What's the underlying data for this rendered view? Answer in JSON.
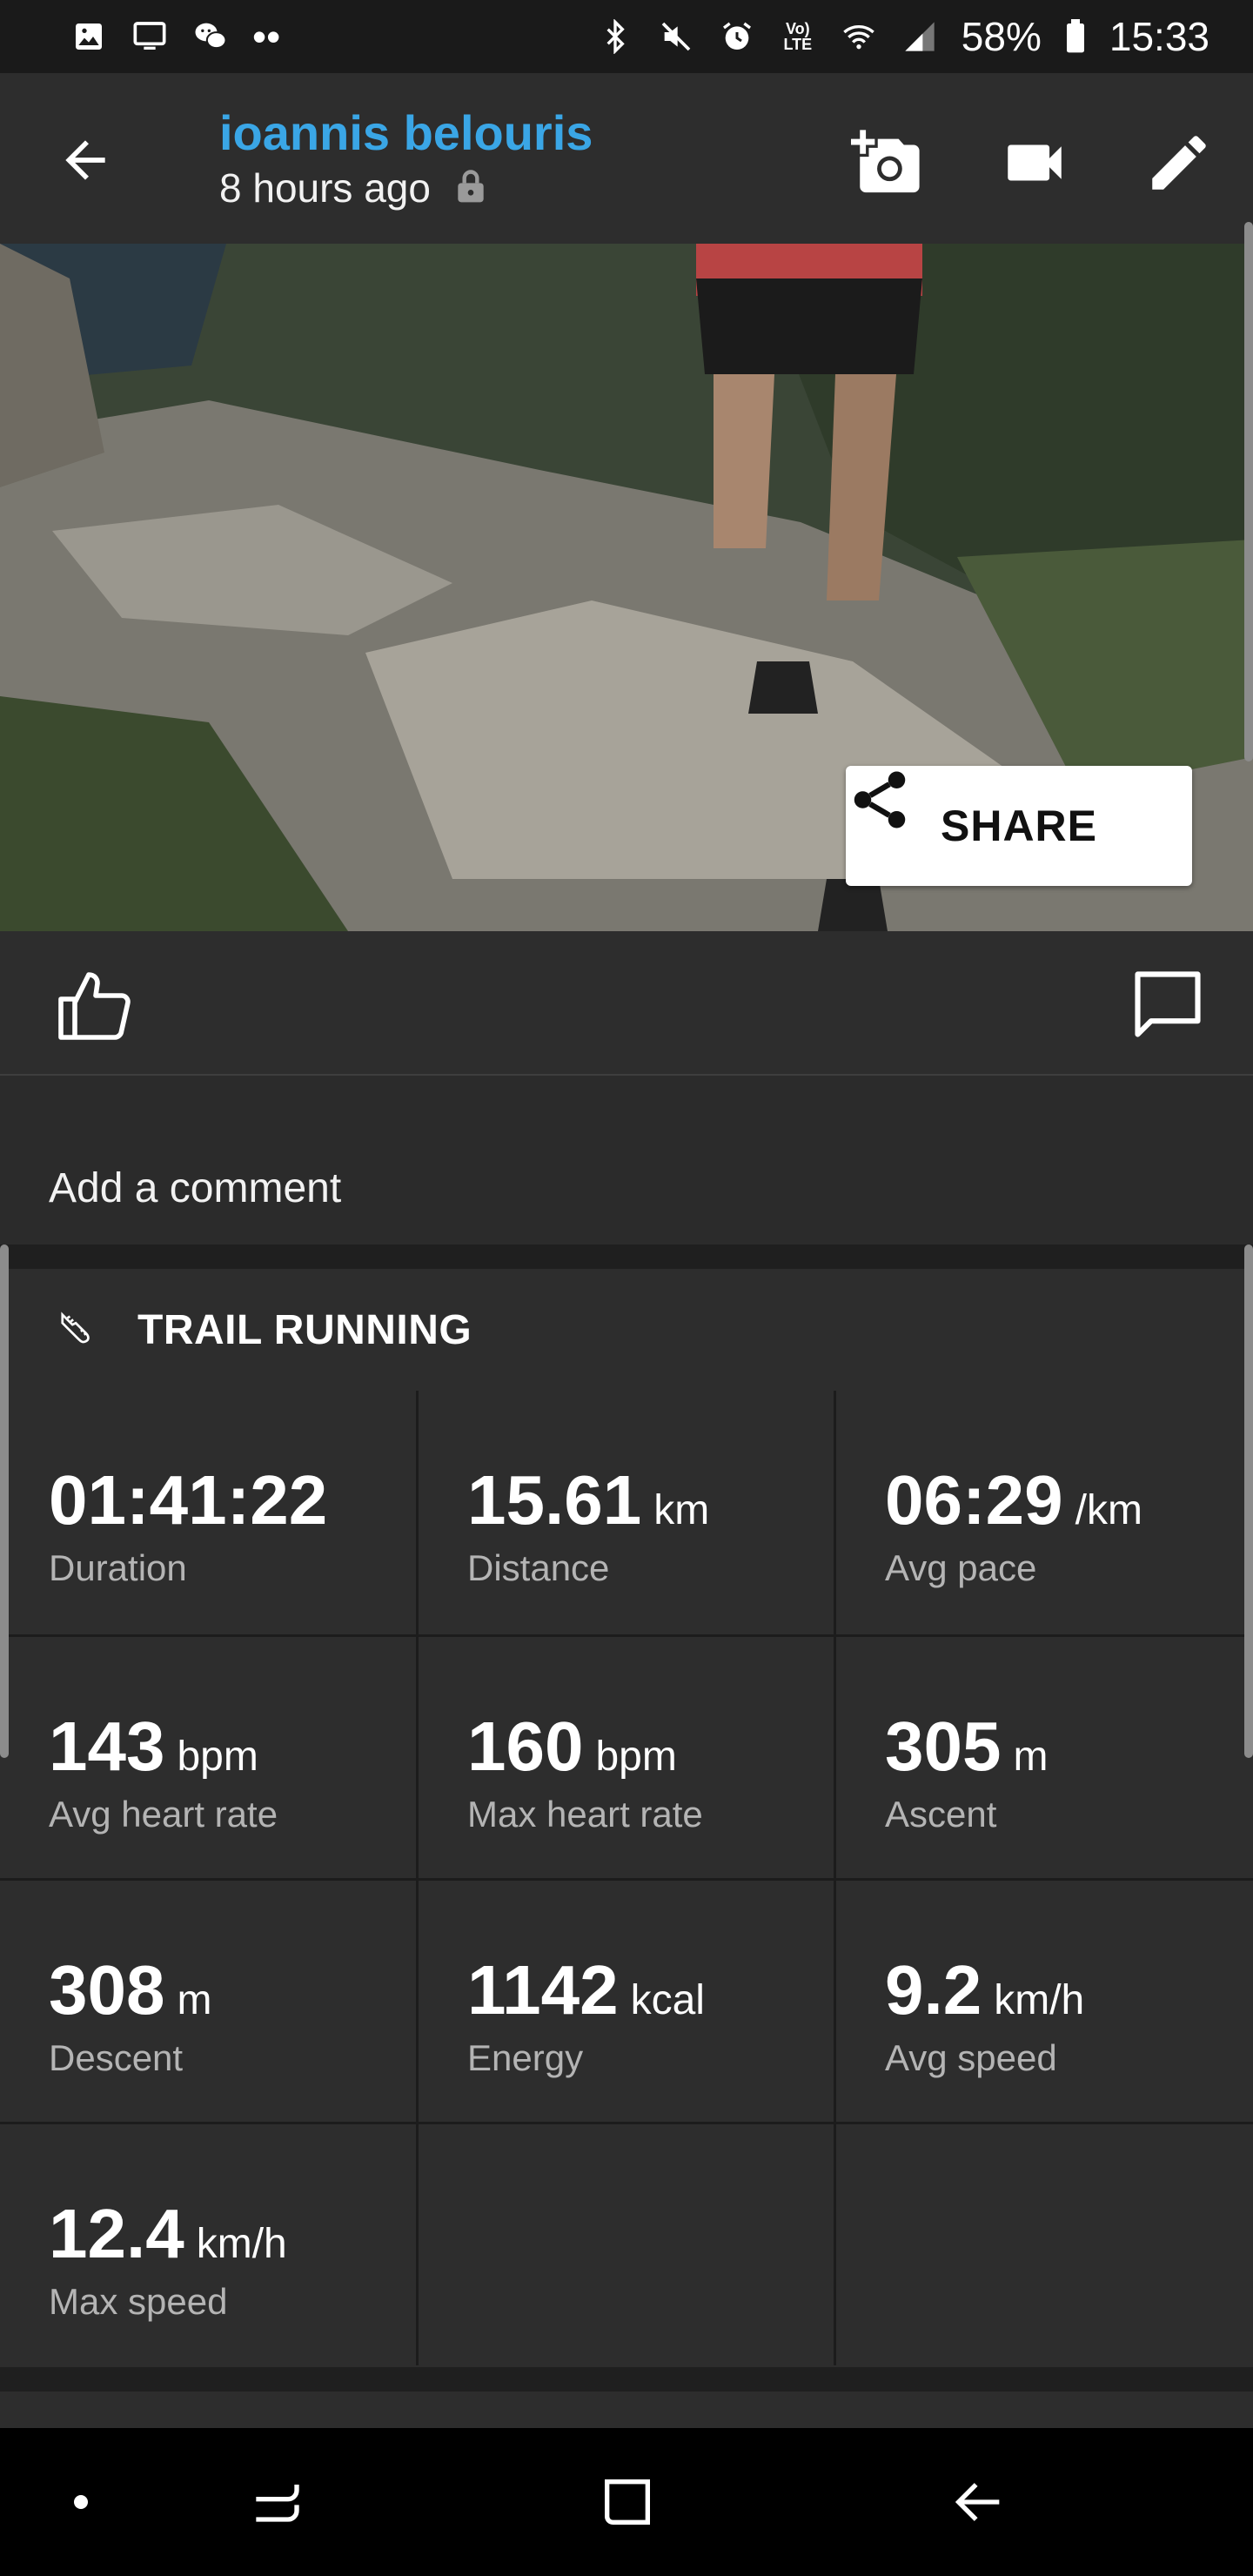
{
  "status_bar": {
    "battery": "58%",
    "time": "15:33",
    "lte_label_top": "Vo)",
    "lte_label_bottom": "LTE",
    "dots": "••",
    "icons": [
      "gallery-icon",
      "cast-icon",
      "wechat-icon",
      "bluetooth-icon",
      "mute-icon",
      "alarm-icon",
      "volte-icon",
      "wifi-icon",
      "signal-icon",
      "battery-icon"
    ]
  },
  "header": {
    "user_name": "ioannis belouris",
    "time_ago": "8 hours ago",
    "icons": [
      "back-arrow-icon",
      "lock-icon",
      "add-photo-icon",
      "video-camera-icon",
      "edit-pencil-icon"
    ]
  },
  "hero": {
    "share_label": "SHARE"
  },
  "reactions": {
    "icons": [
      "thumbs-up-icon",
      "comment-bubble-icon"
    ]
  },
  "comment": {
    "placeholder": "Add a comment"
  },
  "activity": {
    "title": "TRAIL RUNNING",
    "icon": "shoe-icon",
    "stats": [
      {
        "value": "01:41:22",
        "unit": "",
        "label": "Duration"
      },
      {
        "value": "15.61",
        "unit": "km",
        "label": "Distance"
      },
      {
        "value": "06:29",
        "unit": "/km",
        "label": "Avg pace"
      },
      {
        "value": "143",
        "unit": "bpm",
        "label": "Avg heart rate"
      },
      {
        "value": "160",
        "unit": "bpm",
        "label": "Max heart rate"
      },
      {
        "value": "305",
        "unit": "m",
        "label": "Ascent"
      },
      {
        "value": "308",
        "unit": "m",
        "label": "Descent"
      },
      {
        "value": "1142",
        "unit": "kcal",
        "label": "Energy"
      },
      {
        "value": "9.2",
        "unit": "km/h",
        "label": "Avg speed"
      },
      {
        "value": "12.4",
        "unit": "km/h",
        "label": "Max speed"
      }
    ]
  },
  "nav": {
    "icons": [
      "nav-dot-icon",
      "recents-icon",
      "home-icon",
      "back-icon"
    ]
  },
  "colors": {
    "accent": "#3aa6e6",
    "background": "#2b2b2b",
    "card": "#2d2d2d",
    "label_gray": "#b4b4b4"
  }
}
